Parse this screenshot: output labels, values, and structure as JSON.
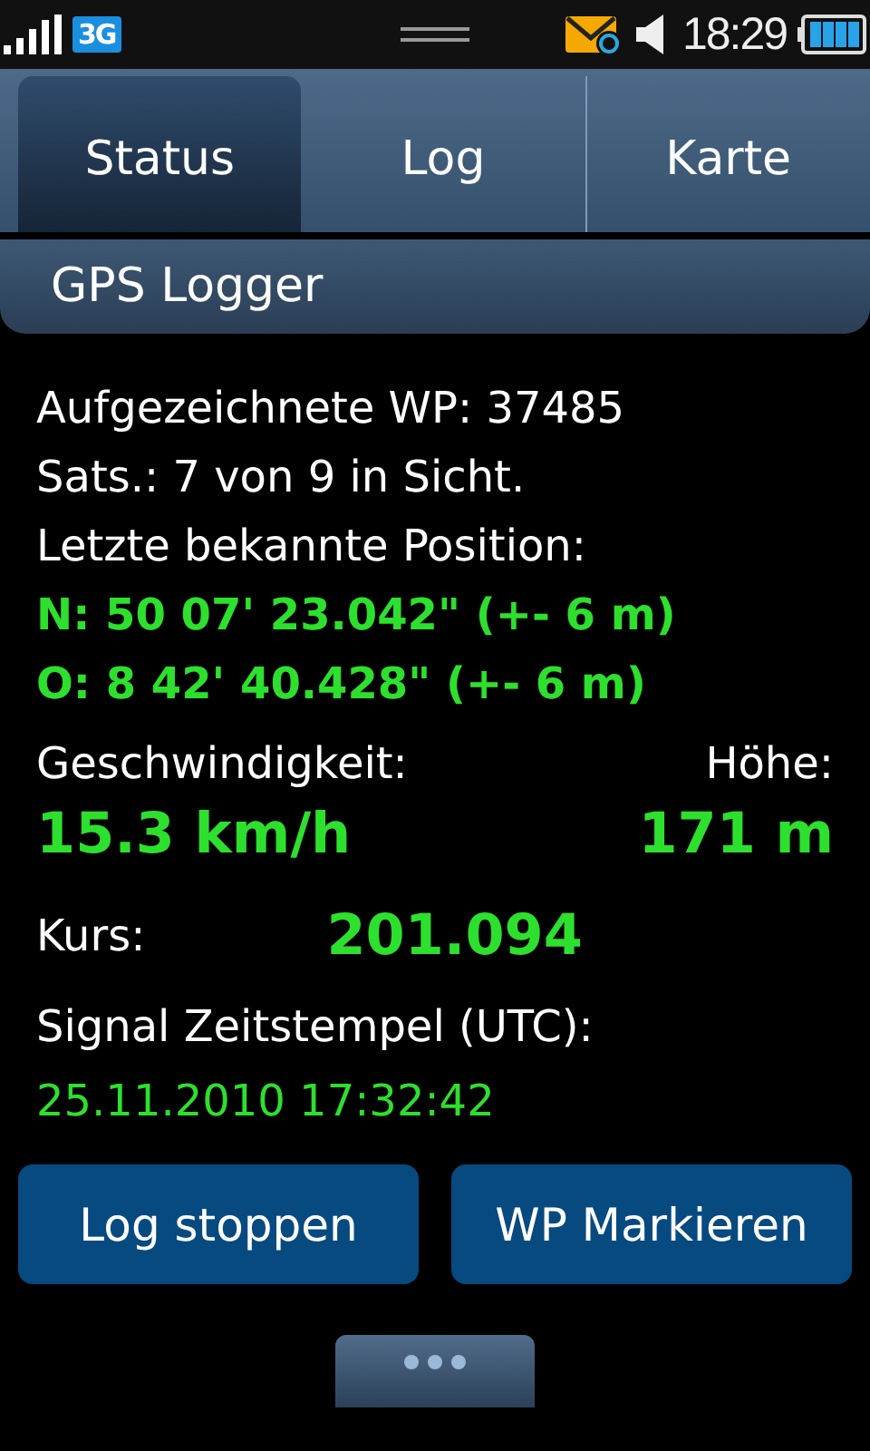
{
  "status_bar": {
    "network": "3G",
    "time": "18:29"
  },
  "tabs": [
    {
      "label": "Status",
      "selected": true
    },
    {
      "label": "Log",
      "selected": false
    },
    {
      "label": "Karte",
      "selected": false
    }
  ],
  "title": "GPS Logger",
  "info_lines": [
    {
      "text": "Aufgezeichnete WP: 37485",
      "kind": "plain"
    },
    {
      "text": "Sats.: 7 von 9 in Sicht.",
      "kind": "plain"
    },
    {
      "text": "Letzte bekannte Position:",
      "kind": "plain"
    },
    {
      "text": "N: 50 07' 23.042\" (+- 6 m)",
      "kind": "value"
    },
    {
      "text": "O: 8 42' 40.428\" (+- 6 m)",
      "kind": "value"
    }
  ],
  "speed": {
    "label": "Geschwindigkeit:",
    "value": "15.3 km/h"
  },
  "altitude": {
    "label": "Höhe:",
    "value": "171 m"
  },
  "course": {
    "label": "Kurs:",
    "value": "201.094"
  },
  "timestamp": {
    "label": "Signal Zeitstempel (UTC):",
    "value": "25.11.2010 17:32:42"
  },
  "buttons": [
    "Log stoppen",
    "WP Markieren"
  ]
}
